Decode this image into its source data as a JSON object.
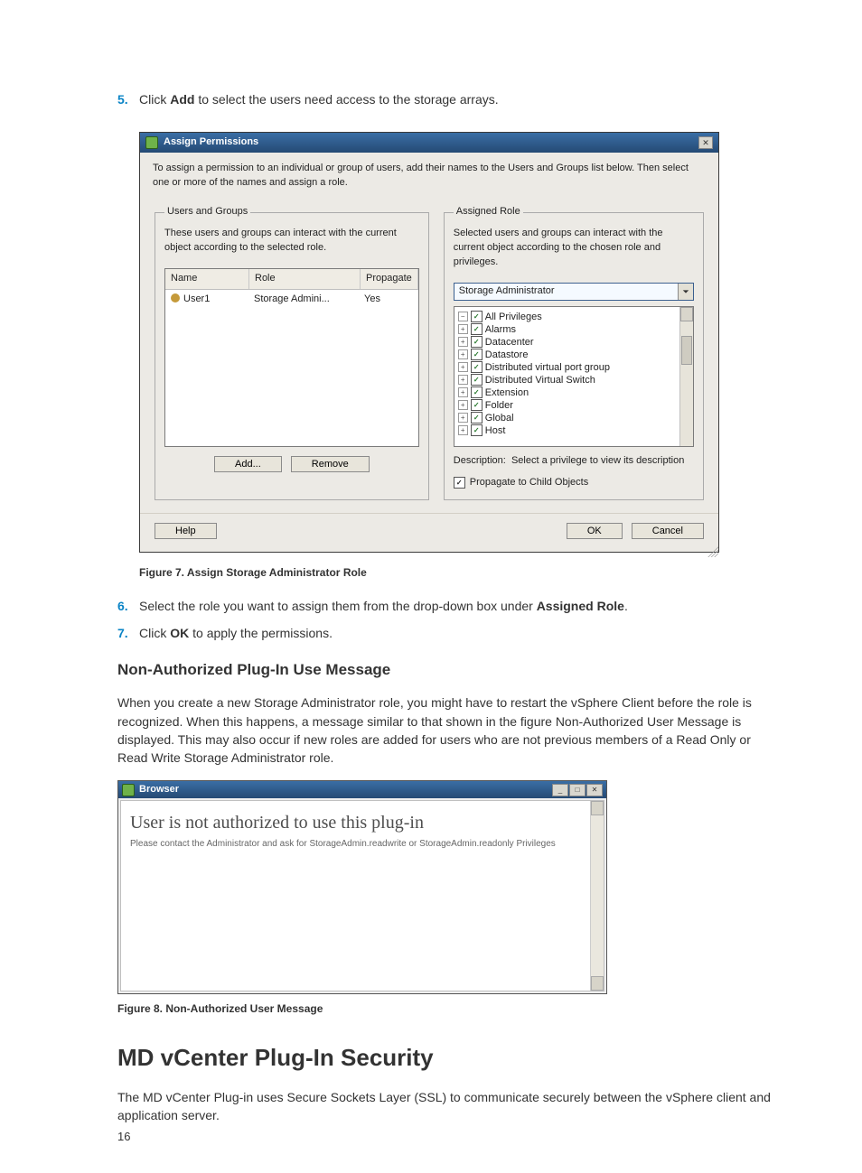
{
  "steps_block1": {
    "5": {
      "prefix": "Click ",
      "bold": "Add",
      "suffix": " to select the users need access to the storage arrays."
    }
  },
  "assign_dialog": {
    "title": "Assign Permissions",
    "instruction": "To assign a permission to an individual or group of users, add their names to the Users and Groups list below. Then select one or more of the names and assign a role.",
    "users_panel": {
      "legend": "Users and Groups",
      "sub": "These users and groups can interact with the current object according to the selected role.",
      "columns": {
        "name": "Name",
        "role": "Role",
        "propagate": "Propagate"
      },
      "rows": [
        {
          "name": "User1",
          "role": "Storage Admini...",
          "propagate": "Yes"
        }
      ],
      "add_btn": "Add...",
      "remove_btn": "Remove"
    },
    "role_panel": {
      "legend": "Assigned Role",
      "sub": "Selected users and groups can interact with the current object according to the chosen role and privileges.",
      "selected_role": "Storage Administrator",
      "privs": [
        {
          "exp": "-",
          "label": "All Privileges",
          "children": [
            {
              "exp": "+",
              "label": "Alarms"
            },
            {
              "exp": "+",
              "label": "Datacenter"
            },
            {
              "exp": "+",
              "label": "Datastore"
            },
            {
              "exp": "+",
              "label": "Distributed virtual port group"
            },
            {
              "exp": "+",
              "label": "Distributed Virtual Switch"
            },
            {
              "exp": "+",
              "label": "Extension"
            },
            {
              "exp": "+",
              "label": "Folder"
            },
            {
              "exp": "+",
              "label": "Global"
            },
            {
              "exp": "+",
              "label": "Host"
            }
          ]
        }
      ],
      "description_label": "Description:",
      "description_text": "Select a privilege to view its description",
      "propagate_label": "Propagate to Child Objects"
    },
    "footer": {
      "help": "Help",
      "ok": "OK",
      "cancel": "Cancel"
    }
  },
  "fig7": "Figure 7. Assign Storage Administrator Role",
  "steps_block2": {
    "6": {
      "prefix": "Select the role you want to assign them from the drop-down box under ",
      "bold": "Assigned Role",
      "suffix": "."
    },
    "7": {
      "prefix": "Click ",
      "bold": "OK",
      "suffix": " to apply the permissions."
    }
  },
  "sec_nonauth_title": "Non-Authorized Plug-In Use Message",
  "sec_nonauth_para": "When you create a new Storage Administrator role, you might have to restart the vSphere Client before the role is recognized. When this happens, a message similar to that shown in the figure Non-Authorized User Message is displayed. This may also occur if new roles are added for users who are not previous members of a Read Only or Read Write Storage Administrator role.",
  "browser_dialog": {
    "title": "Browser",
    "heading": "User is not authorized to use this plug-in",
    "sub": "Please contact the Administrator and ask for StorageAdmin.readwrite or StorageAdmin.readonly Privileges"
  },
  "fig8": "Figure 8. Non-Authorized User Message",
  "sec_security_title": "MD vCenter Plug-In Security",
  "sec_security_para": "The MD vCenter Plug-in uses Secure Sockets Layer (SSL) to communicate securely between the vSphere client and application server.",
  "page_number": "16"
}
